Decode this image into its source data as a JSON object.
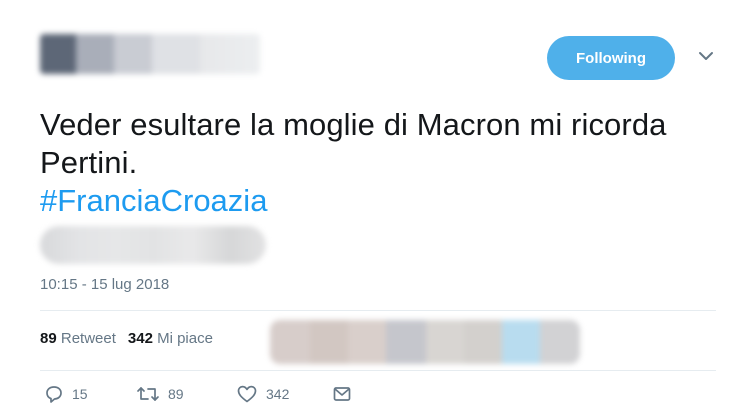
{
  "header": {
    "follow_label": "Following"
  },
  "tweet": {
    "text": "Veder esultare la moglie di Macron mi ricorda Pertini.",
    "hashtag": "#FranciaCroazia",
    "timestamp": "10:15 - 15 lug 2018"
  },
  "stats": {
    "retweets_count": "89",
    "retweets_label": "Retweet",
    "likes_count": "342",
    "likes_label": "Mi piace"
  },
  "actions": {
    "reply_count": "15",
    "retweet_count": "89",
    "like_count": "342"
  },
  "colors": {
    "accent": "#1d9bf0",
    "follow_button": "#4fb0ea",
    "muted": "#657786"
  },
  "icons": {
    "caret": "chevron-down-icon",
    "reply": "reply-icon",
    "retweet": "retweet-icon",
    "like": "heart-icon",
    "dm": "envelope-icon"
  }
}
